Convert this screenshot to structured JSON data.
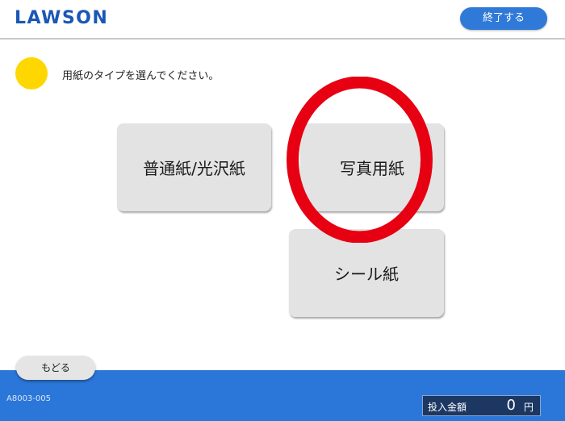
{
  "header": {
    "logo": "LAWSON",
    "exit_label": "終了する"
  },
  "instruction": {
    "text": "用紙のタイプを選んでください。",
    "icon": "yellow-circle-icon",
    "icon_color": "#ffd700"
  },
  "options": [
    {
      "label": "普通紙/光沢紙"
    },
    {
      "label": "写真用紙",
      "highlighted": true
    },
    {
      "label": "シール紙"
    }
  ],
  "highlight": {
    "color": "#e60012"
  },
  "back_label": "もどる",
  "footer": {
    "screen_code": "A8003-005",
    "amount_label": "投入金額",
    "amount_value": "0",
    "amount_unit": "円"
  },
  "colors": {
    "brand": "#1a57b6",
    "accent": "#2f7ad8",
    "footer": "#2b77d9"
  }
}
